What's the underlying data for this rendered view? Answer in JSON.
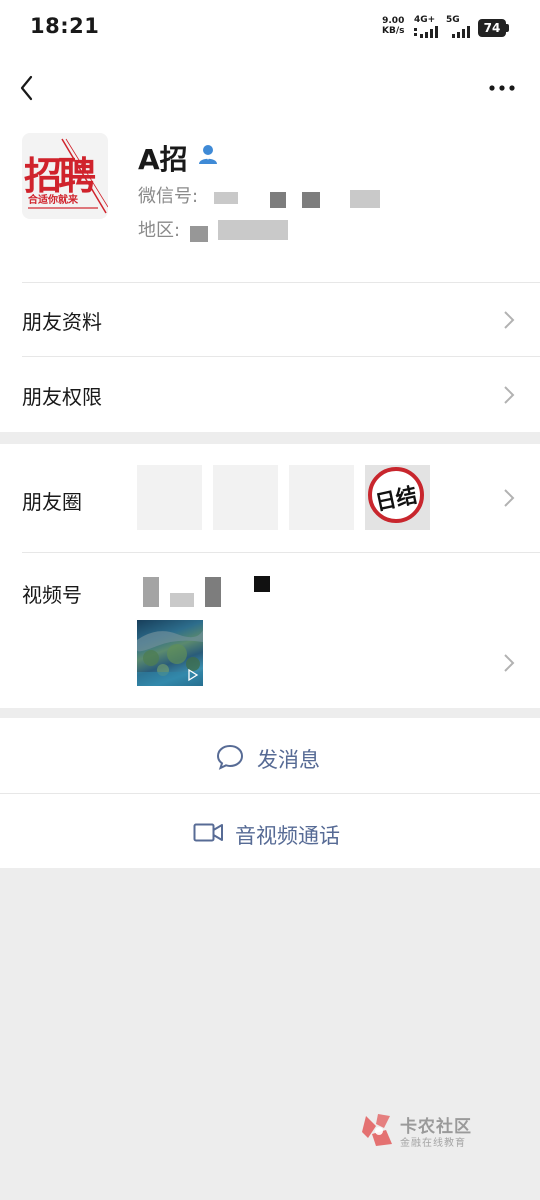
{
  "status_bar": {
    "time": "18:21",
    "net_speed_value": "9.00",
    "net_speed_unit": "KB/s",
    "signal1_label": "4G+",
    "signal2_label": "5G",
    "battery": "74"
  },
  "profile": {
    "name": "A招",
    "wechat_id_label": "微信号: ",
    "region_label": "地区: ",
    "avatar_main_text": "招聘",
    "avatar_sub_text": "合适你就来"
  },
  "menu": {
    "friend_info": "朋友资料",
    "friend_permissions": "朋友权限",
    "moments": "朋友圈",
    "moments_stamp_text": "日结",
    "channels": "视频号"
  },
  "actions": {
    "send_message": "发消息",
    "av_call": "音视频通话"
  },
  "watermark": {
    "title": "卡农社区",
    "subtitle": "金融在线教育"
  },
  "colors": {
    "link_blue": "#576b95",
    "stamp_red": "#c8262d",
    "page_bg": "#ededed"
  }
}
